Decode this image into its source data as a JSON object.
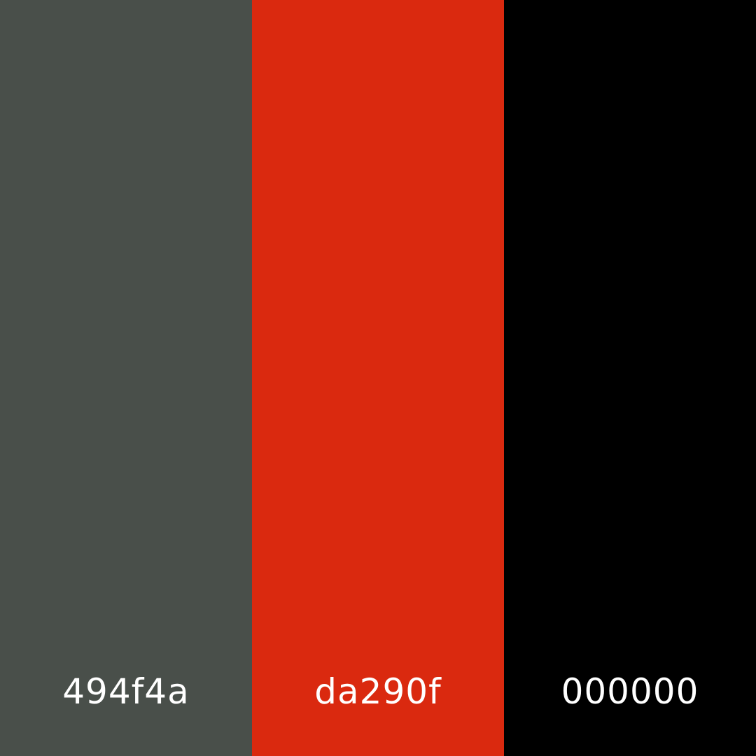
{
  "swatches": [
    {
      "hex": "494f4a",
      "color": "#494f4a"
    },
    {
      "hex": "da290f",
      "color": "#da290f"
    },
    {
      "hex": "000000",
      "color": "#000000"
    }
  ]
}
